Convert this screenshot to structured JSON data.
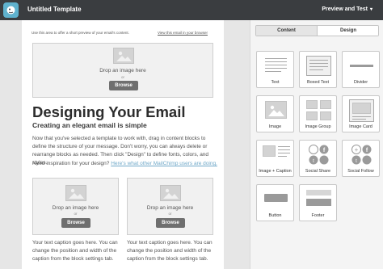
{
  "app": {
    "title": "Untitled Template",
    "preview_label": "Preview and Test",
    "preview_caret": "▾",
    "colors": {
      "topbar": "#3a3d40",
      "logo": "#5fb2ce",
      "link": "#6fa8c8",
      "button": "#6f6f6f"
    }
  },
  "email": {
    "preheader_text": "Use this area to offer a short preview of your email's content.",
    "view_in_browser": "View this email in your browser",
    "header_image": {
      "drop_text": "Drop an image here",
      "or_text": "or",
      "browse_label": "Browse"
    },
    "heading": "Designing Your Email",
    "subheading": "Creating an elegant email is simple",
    "body_text": "Now that you've selected a template to work with, drag in content blocks to define the structure of your message. Don't worry, you can always delete or rearrange blocks as needed. Then click \"Design\" to define fonts, colors, and styles.",
    "inspiration_text": "Need inspiration for your design?",
    "inspiration_link": "Here's what other MailChimp users are doing.",
    "columns": [
      {
        "drop_text": "Drop an image here",
        "or_text": "or",
        "browse_label": "Browse",
        "caption": "Your text caption goes here. You can change the position and width of the caption from the block settings tab."
      },
      {
        "drop_text": "Drop an image here",
        "or_text": "or",
        "browse_label": "Browse",
        "caption": "Your text caption goes here. You can change the position and width of the caption from the block settings tab."
      }
    ]
  },
  "sidebar": {
    "tabs": [
      {
        "label": "Content",
        "active": true
      },
      {
        "label": "Design",
        "active": false
      }
    ],
    "blocks": [
      {
        "label": "Text",
        "icon": "text-icon"
      },
      {
        "label": "Boxed Text",
        "icon": "boxed-text-icon"
      },
      {
        "label": "Divider",
        "icon": "divider-icon"
      },
      {
        "label": "Image",
        "icon": "image-icon"
      },
      {
        "label": "Image Group",
        "icon": "image-group-icon"
      },
      {
        "label": "Image Card",
        "icon": "image-card-icon"
      },
      {
        "label": "Image + Caption",
        "icon": "image-caption-icon"
      },
      {
        "label": "Social Share",
        "icon": "social-share-icon"
      },
      {
        "label": "Social Follow",
        "icon": "social-follow-icon"
      },
      {
        "label": "Button",
        "icon": "button-icon"
      },
      {
        "label": "Footer",
        "icon": "footer-icon"
      }
    ]
  }
}
